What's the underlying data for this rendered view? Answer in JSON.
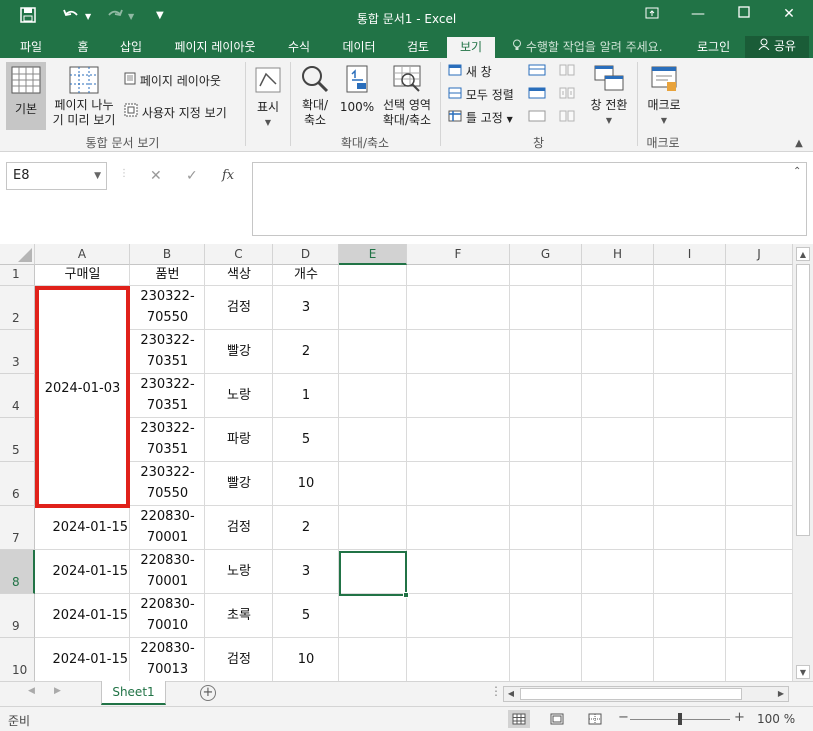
{
  "window": {
    "title": "통합 문서1 - Excel",
    "minimize_icon": "minimize-icon",
    "maximize_icon": "maximize-icon",
    "close_icon": "close-icon"
  },
  "quick_access": [
    "save-icon",
    "undo-icon",
    "redo-icon",
    "customize-icon"
  ],
  "ribbon_tabs": [
    "파일",
    "홈",
    "삽입",
    "페이지 레이아웃",
    "수식",
    "데이터",
    "검토",
    "보기"
  ],
  "active_tab": "보기",
  "tell_me": "수행할 작업을 알려 주세요.",
  "login": "로그인",
  "share": "공유",
  "ribbon": {
    "views": {
      "normal": "기본",
      "page_break_1": "페이지 나누",
      "page_break_2": "기 미리 보기",
      "page_layout": "페이지 레이아웃",
      "custom_views": "사용자 지정 보기",
      "group": "통합 문서 보기"
    },
    "show": {
      "label": "표시"
    },
    "zoom": {
      "zoom_1": "확대/",
      "zoom_2": "축소",
      "hundred": "100%",
      "selection_1": "선택 영역",
      "selection_2": "확대/축소",
      "group": "확대/축소"
    },
    "window": {
      "new_window": "새 창",
      "arrange_all": "모두 정렬",
      "freeze_panes": "틀 고정",
      "switch_windows": "창 전환",
      "group": "창"
    },
    "macros": {
      "label": "매크로",
      "group": "매크로"
    }
  },
  "formula_bar": {
    "name_box": "E8",
    "formula": ""
  },
  "columns": [
    "A",
    "B",
    "C",
    "D",
    "E",
    "F",
    "G",
    "H",
    "I",
    "J"
  ],
  "selected_column": "E",
  "selected_row": "8",
  "headers": {
    "A": "구매일",
    "B": "품번",
    "C": "색상",
    "D": "개수"
  },
  "merged_date": "2024-01-03",
  "rows": [
    {
      "num": "1"
    },
    {
      "num": "2",
      "b1": "230322-",
      "b2": "70550",
      "c": "검정",
      "d": "3"
    },
    {
      "num": "3",
      "b1": "230322-",
      "b2": "70351",
      "c": "빨강",
      "d": "2"
    },
    {
      "num": "4",
      "b1": "230322-",
      "b2": "70351",
      "c": "노랑",
      "d": "1"
    },
    {
      "num": "5",
      "b1": "230322-",
      "b2": "70351",
      "c": "파랑",
      "d": "5"
    },
    {
      "num": "6",
      "b1": "230322-",
      "b2": "70550",
      "c": "빨강",
      "d": "10"
    },
    {
      "num": "7",
      "a": "2024-01-15",
      "b1": "220830-",
      "b2": "70001",
      "c": "검정",
      "d": "2"
    },
    {
      "num": "8",
      "a": "2024-01-15",
      "b1": "220830-",
      "b2": "70001",
      "c": "노랑",
      "d": "3"
    },
    {
      "num": "9",
      "a": "2024-01-15",
      "b1": "220830-",
      "b2": "70010",
      "c": "초록",
      "d": "5"
    },
    {
      "num": "10",
      "a": "2024-01-15",
      "b1": "220830-",
      "b2": "70013",
      "c": "검정",
      "d": "10"
    }
  ],
  "sheet_tab": "Sheet1",
  "status": {
    "ready": "준비",
    "zoom": "100 %"
  },
  "colors": {
    "excel_green": "#217346",
    "merged_border": "#e0211a"
  }
}
